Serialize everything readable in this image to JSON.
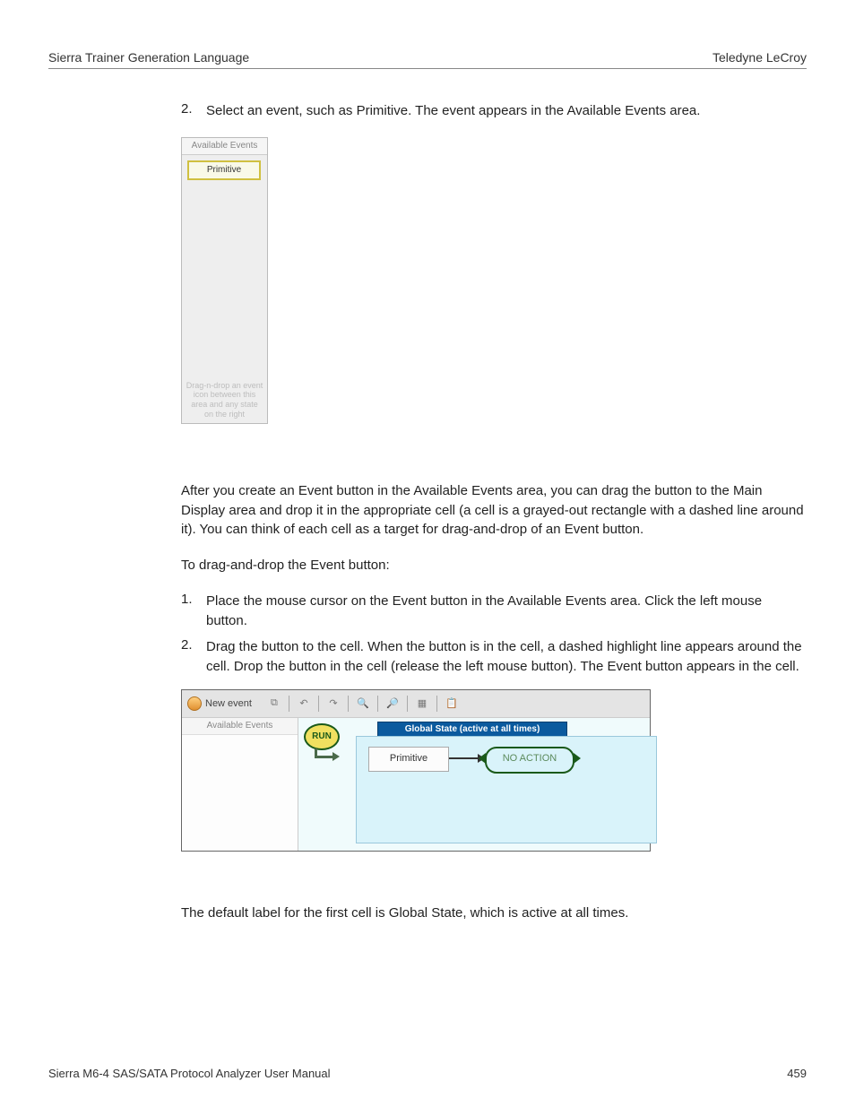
{
  "header": {
    "left": "Sierra Trainer Generation Language",
    "right": "Teledyne LeCroy"
  },
  "step2": {
    "num": "2.",
    "text": "Select an event, such as Primitive. The event appears in the Available Events area."
  },
  "panel1": {
    "title": "Available Events",
    "item": "Primitive",
    "hint": "Drag-n-drop an event icon between this area and any state on the right"
  },
  "afterText": "After you create an Event button in the Available Events area, you can drag the button to the Main Display area and drop it in the appropriate cell (a cell is a grayed-out rectangle with a dashed line around it). You can think of each cell as a target for drag-and-drop of an Event button.",
  "toDrag": "To drag-and-drop the Event button:",
  "list": [
    {
      "num": "1.",
      "text": "Place the mouse cursor on the Event button in the Available Events area. Click the left mouse button."
    },
    {
      "num": "2.",
      "text": "Drag the button to the cell. When the button is in the cell, a dashed highlight line appears around the cell. Drop the button in the cell (release the left mouse button). The Event button appears in the cell."
    }
  ],
  "panel2": {
    "newEvent": "New event",
    "sideTitle": "Available Events",
    "run": "RUN",
    "stateHdr": "Global State (active at all times)",
    "primitive": "Primitive",
    "noaction": "NO ACTION"
  },
  "defaultLabel": "The default label for the first cell is Global State, which is active at all times.",
  "footer": {
    "left": "Sierra M6-4 SAS/SATA Protocol Analyzer User Manual",
    "right": "459"
  }
}
